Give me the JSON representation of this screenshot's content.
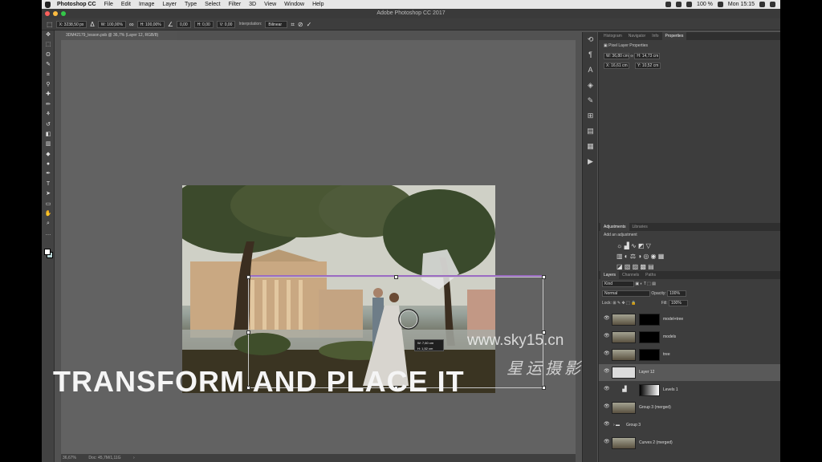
{
  "menubar": {
    "app_name": "Photoshop CC",
    "items": [
      "File",
      "Edit",
      "Image",
      "Layer",
      "Type",
      "Select",
      "Filter",
      "3D",
      "View",
      "Window",
      "Help"
    ],
    "battery": "100 %",
    "clock": "Mon 15:15"
  },
  "window": {
    "title": "Adobe Photoshop CC 2017"
  },
  "options_bar": {
    "x": "X: 3238,50 px",
    "w": "W: 100,00%",
    "h": "H: 100,00%",
    "angle": "0,00",
    "hskew": "H: 0,00",
    "vskew": "V: 0,00",
    "interpolation_label": "Interpolation:",
    "interpolation_value": "Bilinear"
  },
  "document": {
    "tab_title": "3DM42179_lesson.psb @ 36,7% (Layer 12, RGB/8)",
    "zoom": "36,67%",
    "doc_size": "Doc: 45,7M/1,11G"
  },
  "canvas": {
    "transform_tooltip_w": "W: 7,60 cm",
    "transform_tooltip_h": "H: 1,52 cm",
    "watermark_url": "www.sky15.cn",
    "watermark_cn": "星运摄影"
  },
  "caption": "TRANSFORM AND PLACE IT",
  "properties_panel": {
    "tabs": [
      "Histogram",
      "Navigator",
      "Info",
      "Properties"
    ],
    "active_tab": "Properties",
    "header": "Pixel Layer Properties",
    "w": "W: 36,80 cm",
    "h": "H: 14,73 cm",
    "x": "X: 16,61 cm",
    "y": "Y: 10,52 cm"
  },
  "adjustments_panel": {
    "tabs": [
      "Adjustments",
      "Libraries"
    ],
    "subtitle": "Add an adjustment"
  },
  "layers_panel": {
    "tabs": [
      "Layers",
      "Channels",
      "Paths"
    ],
    "filter_label": "Kind",
    "blend_mode": "Normal",
    "opacity_label": "Opacity:",
    "opacity_value": "100%",
    "lock_label": "Lock:",
    "fill_label": "Fill:",
    "fill_value": "100%",
    "layers": [
      {
        "name": "model+tree"
      },
      {
        "name": "models"
      },
      {
        "name": "tree"
      },
      {
        "name": "Layer 12"
      },
      {
        "name": "Levels 1"
      },
      {
        "name": "Group 3 (merged)"
      },
      {
        "name": "Group 3"
      },
      {
        "name": "Curves 2 (merged)"
      }
    ]
  }
}
